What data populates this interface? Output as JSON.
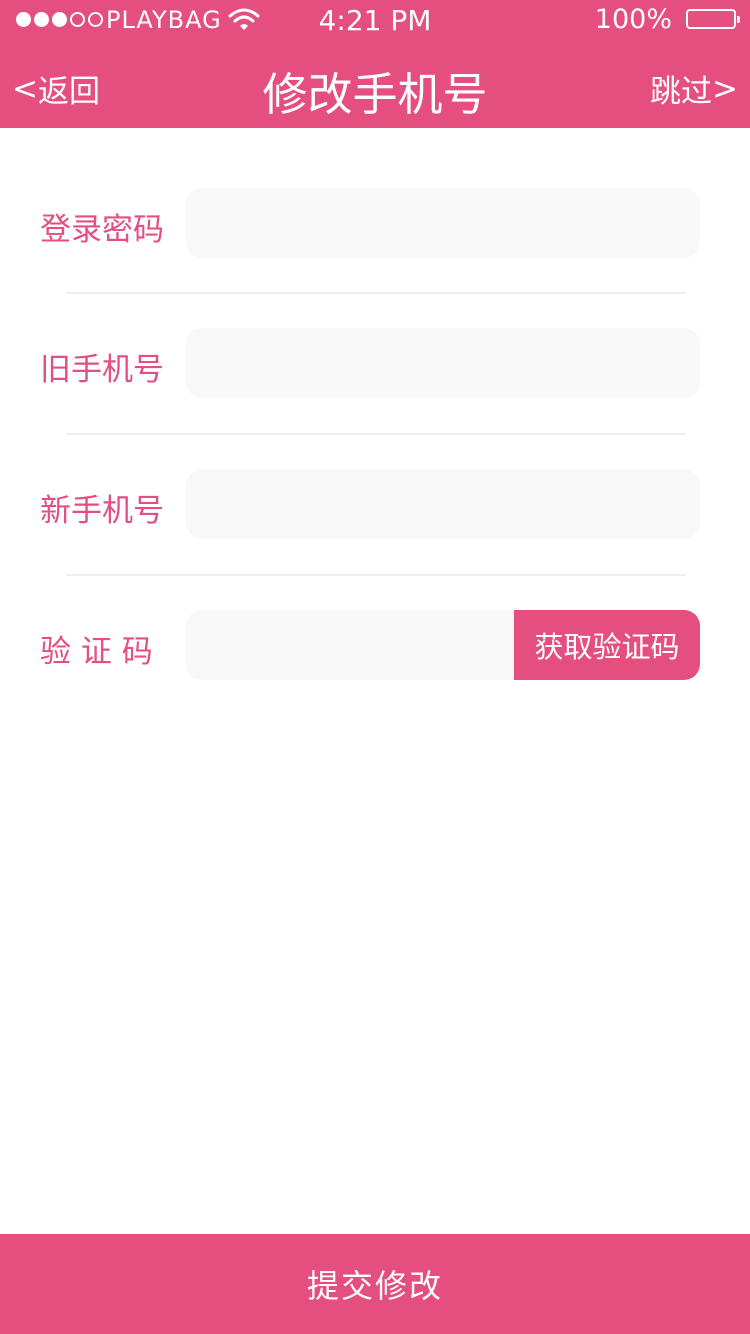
{
  "status_bar": {
    "carrier": "PLAYBAG",
    "time": "4:21 PM",
    "battery": "100%",
    "signal_bars": 3,
    "signal_total": 5
  },
  "nav": {
    "back_label": "返回",
    "back_chevron": "<",
    "title": "修改手机号",
    "skip_label": "跳过",
    "skip_chevron": ">"
  },
  "form": {
    "password_label": "登录密码",
    "password_value": "",
    "old_phone_label": "旧手机号",
    "old_phone_value": "",
    "new_phone_label": "新手机号",
    "new_phone_value": "",
    "code_label": "验 证 码",
    "code_value": "",
    "get_code_button": "获取验证码"
  },
  "submit_label": "提交修改",
  "colors": {
    "accent": "#e54f80",
    "input_bg": "#f8f8f8",
    "divider": "#eeeeee"
  }
}
